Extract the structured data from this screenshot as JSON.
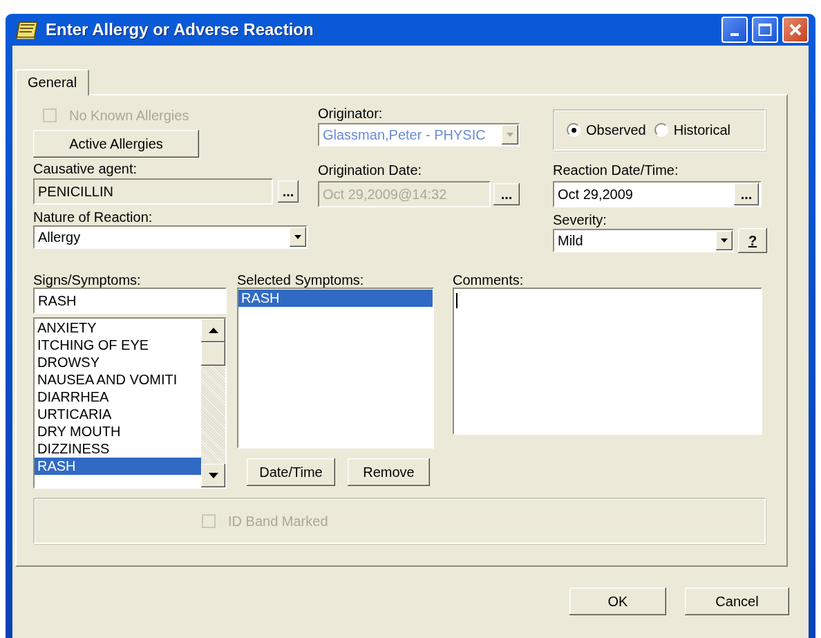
{
  "window": {
    "title": "Enter Allergy or Adverse Reaction"
  },
  "tabs": [
    {
      "label": "General",
      "selected": true
    }
  ],
  "no_known_allergies": {
    "label": "No Known Allergies",
    "checked": false,
    "disabled": true
  },
  "active_allergies_button": "Active Allergies",
  "originator": {
    "label": "Originator:",
    "value": "Glassman,Peter - PHYSIC",
    "disabled": true
  },
  "observation": [
    {
      "label": "Observed",
      "selected": true
    },
    {
      "label": "Historical",
      "selected": false
    }
  ],
  "causative_agent": {
    "label": "Causative agent:",
    "value": "PENICILLIN",
    "browse_button": "..."
  },
  "origination_date": {
    "label": "Origination Date:",
    "value": "Oct 29,2009@14:32",
    "disabled": true,
    "browse_button": "..."
  },
  "reaction_date_time": {
    "label": "Reaction Date/Time:",
    "value": "Oct 29,2009",
    "browse_button": "..."
  },
  "nature_of_reaction": {
    "label": "Nature of Reaction:",
    "value": "Allergy"
  },
  "severity": {
    "label": "Severity:",
    "value": "Mild",
    "help_button": "?"
  },
  "signs_symptoms": {
    "label": "Signs/Symptoms:",
    "search": "RASH",
    "items": [
      {
        "label": "ANXIETY",
        "selected": false
      },
      {
        "label": "ITCHING OF EYE",
        "selected": false
      },
      {
        "label": "DROWSY",
        "selected": false
      },
      {
        "label": "NAUSEA AND VOMITI",
        "selected": false
      },
      {
        "label": "DIARRHEA",
        "selected": false
      },
      {
        "label": "URTICARIA",
        "selected": false
      },
      {
        "label": "DRY MOUTH",
        "selected": false
      },
      {
        "label": "DIZZINESS",
        "selected": false
      },
      {
        "label": "RASH",
        "selected": true
      }
    ]
  },
  "selected_symptoms": {
    "label": "Selected Symptoms:",
    "items": [
      {
        "label": "RASH",
        "selected": true
      }
    ]
  },
  "symptom_buttons": [
    "Date/Time",
    "Remove"
  ],
  "comments": {
    "label": "Comments:"
  },
  "id_band_marked": {
    "label": "ID Band Marked",
    "checked": false,
    "disabled": true
  },
  "buttons": [
    "OK",
    "Cancel"
  ]
}
